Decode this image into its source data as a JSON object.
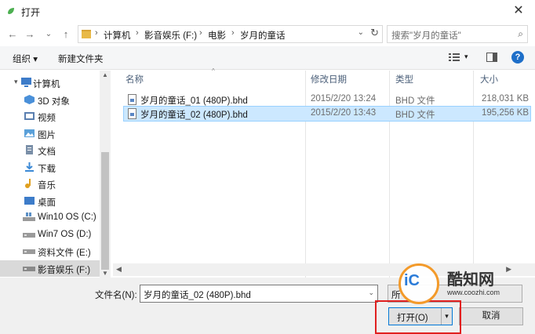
{
  "window": {
    "title": "打开",
    "close_glyph": "✕"
  },
  "nav": {
    "back_glyph": "←",
    "forward_glyph": "→",
    "recent_glyph": "⌄",
    "up_glyph": "↑",
    "breadcrumbs": [
      "计算机",
      "影音娱乐 (F:)",
      "电影",
      "岁月的童话"
    ],
    "separator": "›",
    "dropdown_glyph": "⌄",
    "refresh_glyph": "↻"
  },
  "search": {
    "placeholder": "搜索\"岁月的童话\"",
    "icon_glyph": "⌕"
  },
  "toolbar": {
    "organize_label": "组织 ▾",
    "new_folder_label": "新建文件夹",
    "view_dropdown_glyph": "▾",
    "help_glyph": "?"
  },
  "sidebar": {
    "items": [
      {
        "label": "计算机",
        "icon": "computer-icon",
        "color": "#3d7cc9"
      },
      {
        "label": "3D 对象",
        "icon": "3d-objects-icon",
        "color": "#4a90d9"
      },
      {
        "label": "视频",
        "icon": "videos-icon",
        "color": "#5a7fb0"
      },
      {
        "label": "图片",
        "icon": "pictures-icon",
        "color": "#5aa0d9"
      },
      {
        "label": "文档",
        "icon": "documents-icon",
        "color": "#7a8fa8"
      },
      {
        "label": "下载",
        "icon": "downloads-icon",
        "color": "#3c8ad6"
      },
      {
        "label": "音乐",
        "icon": "music-icon",
        "color": "#e0a020"
      },
      {
        "label": "桌面",
        "icon": "desktop-icon",
        "color": "#3d7cc9"
      },
      {
        "label": "Win10 OS (C:)",
        "icon": "windows-drive-icon",
        "color": "#5a8fc5"
      },
      {
        "label": "Win7 OS (D:)",
        "icon": "drive-icon",
        "color": "#8a8a8a"
      },
      {
        "label": "资料文件 (E:)",
        "icon": "drive-icon",
        "color": "#8a8a8a"
      },
      {
        "label": "影音娱乐 (F:)",
        "icon": "drive-icon",
        "color": "#8a8a8a"
      }
    ],
    "expand_glyph": "▾",
    "scroll_up_glyph": "▲",
    "scroll_down_glyph": "▼"
  },
  "columns": {
    "name": "名称",
    "modified": "修改日期",
    "type": "类型",
    "size": "大小",
    "sort_glyph": "^"
  },
  "files": [
    {
      "name": "岁月的童话_01 (480P).bhd",
      "modified": "2015/2/20 13:24",
      "type": "BHD 文件",
      "size": "218,031 KB"
    },
    {
      "name": "岁月的童话_02 (480P).bhd",
      "modified": "2015/2/20 13:43",
      "type": "BHD 文件",
      "size": "195,256 KB"
    }
  ],
  "hscroll": {
    "left_glyph": "◀",
    "right_glyph": "▶"
  },
  "footer": {
    "filename_label": "文件名(N):",
    "filename_value": "岁月的童话_02 (480P).bhd",
    "filename_dropdown_glyph": "⌄",
    "type_value": "所",
    "open_label": "打开(O)",
    "open_split_glyph": "▾",
    "cancel_label": "取消"
  },
  "watermark": {
    "logo_text": "iC",
    "title": "酷知网",
    "url": "www.coozhi.com"
  },
  "colors": {
    "accent": "#0078d7",
    "selection": "#cce8ff",
    "highlight_box": "#e02020"
  }
}
